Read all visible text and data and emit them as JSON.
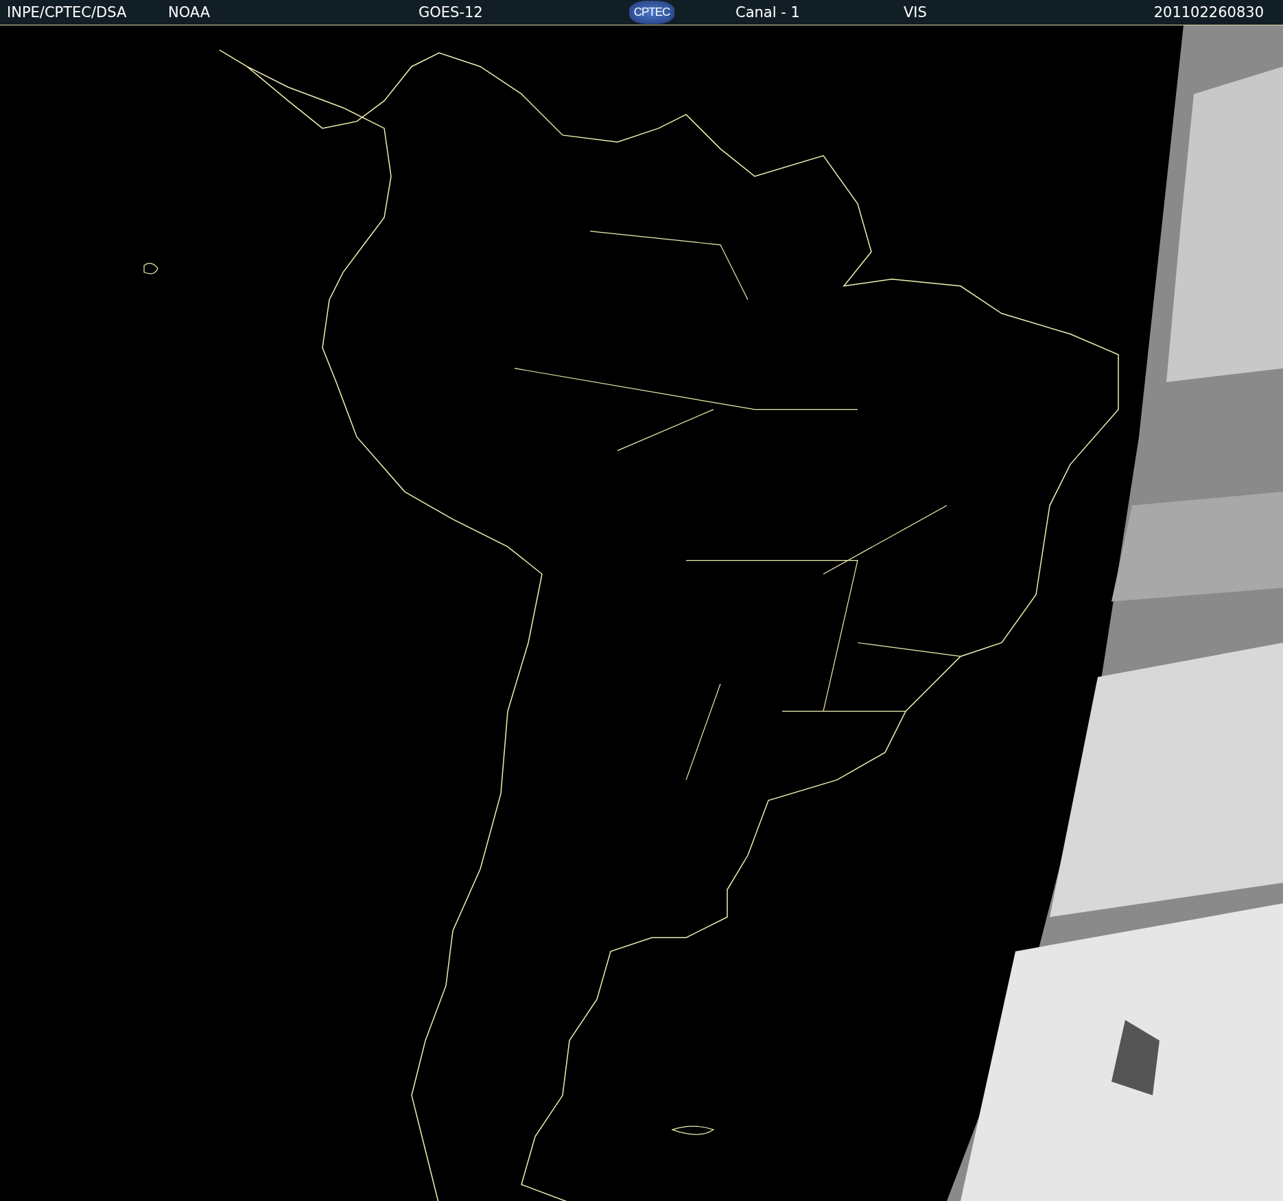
{
  "header": {
    "source": "INPE/CPTEC/DSA",
    "agency": "NOAA",
    "satellite": "GOES-12",
    "logo_text": "CPTEC",
    "channel": "Canal - 1",
    "band": "VIS",
    "timestamp": "201102260830"
  }
}
